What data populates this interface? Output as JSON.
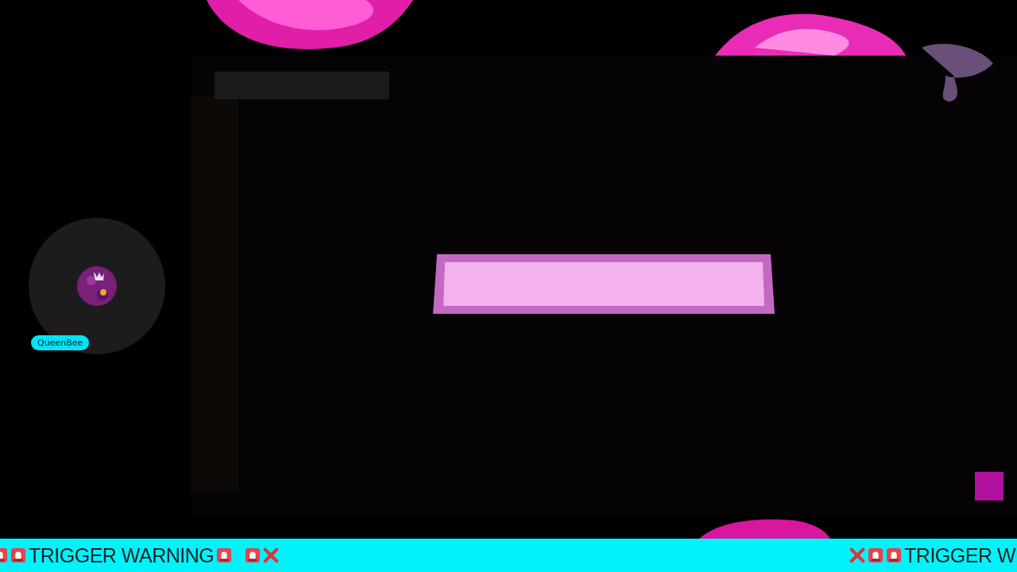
{
  "streamer": {
    "name": "QueenBee"
  },
  "ticker": {
    "left": [
      {
        "kind": "siren"
      },
      {
        "kind": "siren"
      },
      {
        "kind": "text",
        "text": "TRIGGER WARNING"
      },
      {
        "kind": "siren"
      },
      {
        "kind": "gap"
      },
      {
        "kind": "siren"
      },
      {
        "kind": "cross"
      }
    ],
    "right": [
      {
        "kind": "cross"
      },
      {
        "kind": "siren"
      },
      {
        "kind": "siren"
      },
      {
        "kind": "text",
        "text": "TRIGGER W"
      }
    ]
  }
}
